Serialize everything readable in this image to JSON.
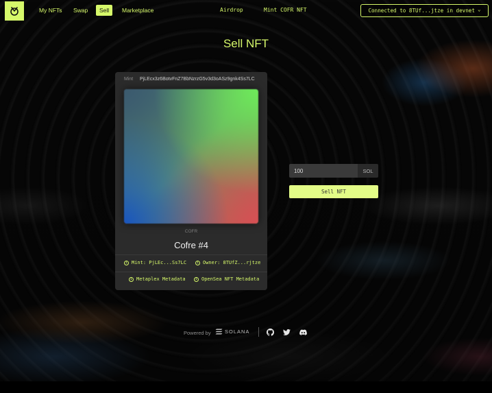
{
  "nav": {
    "links": [
      "My NFTs",
      "Swap",
      "Sell",
      "Marketplace"
    ],
    "active": "Sell",
    "center_links": [
      "Airdrop",
      "Mint COFR NFT"
    ],
    "wallet_label": "Connected to 8TUf...jtze in devnet",
    "wallet_chevron": "⌄"
  },
  "page": {
    "title": "Sell NFT"
  },
  "card": {
    "mint_label": "Mint",
    "mint_address": "PjLEcx3z6BotvFnZ7BbNzrzG5v3d3oASz9gnk4Ss7LC",
    "collection": "COFR",
    "name": "Cofre #4",
    "mint_short": "Mint: PjLEc...Ss7LC",
    "owner_short": "Owner: 8TUfZ...rjtze",
    "metaplex": "Metaplex Metadata",
    "opensea": "OpenSea NFT Metadata",
    "info_icon": "i"
  },
  "sell": {
    "price_value": "100",
    "currency": "SOL",
    "button": "Sell NFT"
  },
  "footer": {
    "powered_by": "Powered by",
    "solana": "SOLANA"
  },
  "colors": {
    "accent": "#d6f86a",
    "button": "#e3fc87",
    "card": "#2b2b2b"
  }
}
